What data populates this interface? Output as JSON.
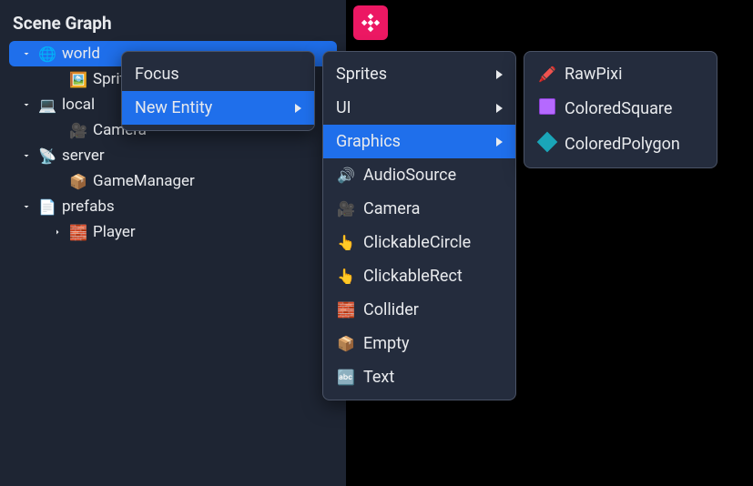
{
  "panel": {
    "title": "Scene Graph",
    "tree": [
      {
        "level": 1,
        "chev": "down",
        "icon": "🌐",
        "label": "world",
        "selected": true
      },
      {
        "level": 2,
        "chev": "",
        "icon": "🖼️",
        "label": "Sprite"
      },
      {
        "level": 1,
        "chev": "down",
        "icon": "💻",
        "label": "local"
      },
      {
        "level": 2,
        "chev": "",
        "icon": "🎥",
        "label": "Camera"
      },
      {
        "level": 1,
        "chev": "down",
        "icon": "📡",
        "label": "server"
      },
      {
        "level": 2,
        "chev": "",
        "icon": "📦",
        "label": "GameManager"
      },
      {
        "level": 1,
        "chev": "down",
        "icon": "📄",
        "label": "prefabs"
      },
      {
        "level": 2,
        "chev": "right",
        "icon": "🧱",
        "label": "Player"
      }
    ]
  },
  "menu1": [
    {
      "label": "Focus",
      "arrow": false,
      "highlight": false
    },
    {
      "label": "New Entity",
      "arrow": true,
      "highlight": true
    }
  ],
  "menu2": [
    {
      "icon": "",
      "label": "Sprites",
      "arrow": true,
      "highlight": false
    },
    {
      "icon": "",
      "label": "UI",
      "arrow": true,
      "highlight": false
    },
    {
      "icon": "",
      "label": "Graphics",
      "arrow": true,
      "highlight": true
    },
    {
      "icon": "🔊",
      "label": "AudioSource",
      "arrow": false,
      "highlight": false
    },
    {
      "icon": "🎥",
      "label": "Camera",
      "arrow": false,
      "highlight": false
    },
    {
      "icon": "👆",
      "label": "ClickableCircle",
      "arrow": false,
      "highlight": false
    },
    {
      "icon": "👆",
      "label": "ClickableRect",
      "arrow": false,
      "highlight": false
    },
    {
      "icon": "🧱",
      "label": "Collider",
      "arrow": false,
      "highlight": false
    },
    {
      "icon": "📦",
      "label": "Empty",
      "arrow": false,
      "highlight": false
    },
    {
      "icon": "🔤",
      "label": "Text",
      "arrow": false,
      "highlight": false
    }
  ],
  "menu3": [
    {
      "swatch": "pencil",
      "label": "RawPixi"
    },
    {
      "swatch": "purple",
      "label": "ColoredSquare"
    },
    {
      "swatch": "diamond",
      "label": "ColoredPolygon"
    }
  ]
}
